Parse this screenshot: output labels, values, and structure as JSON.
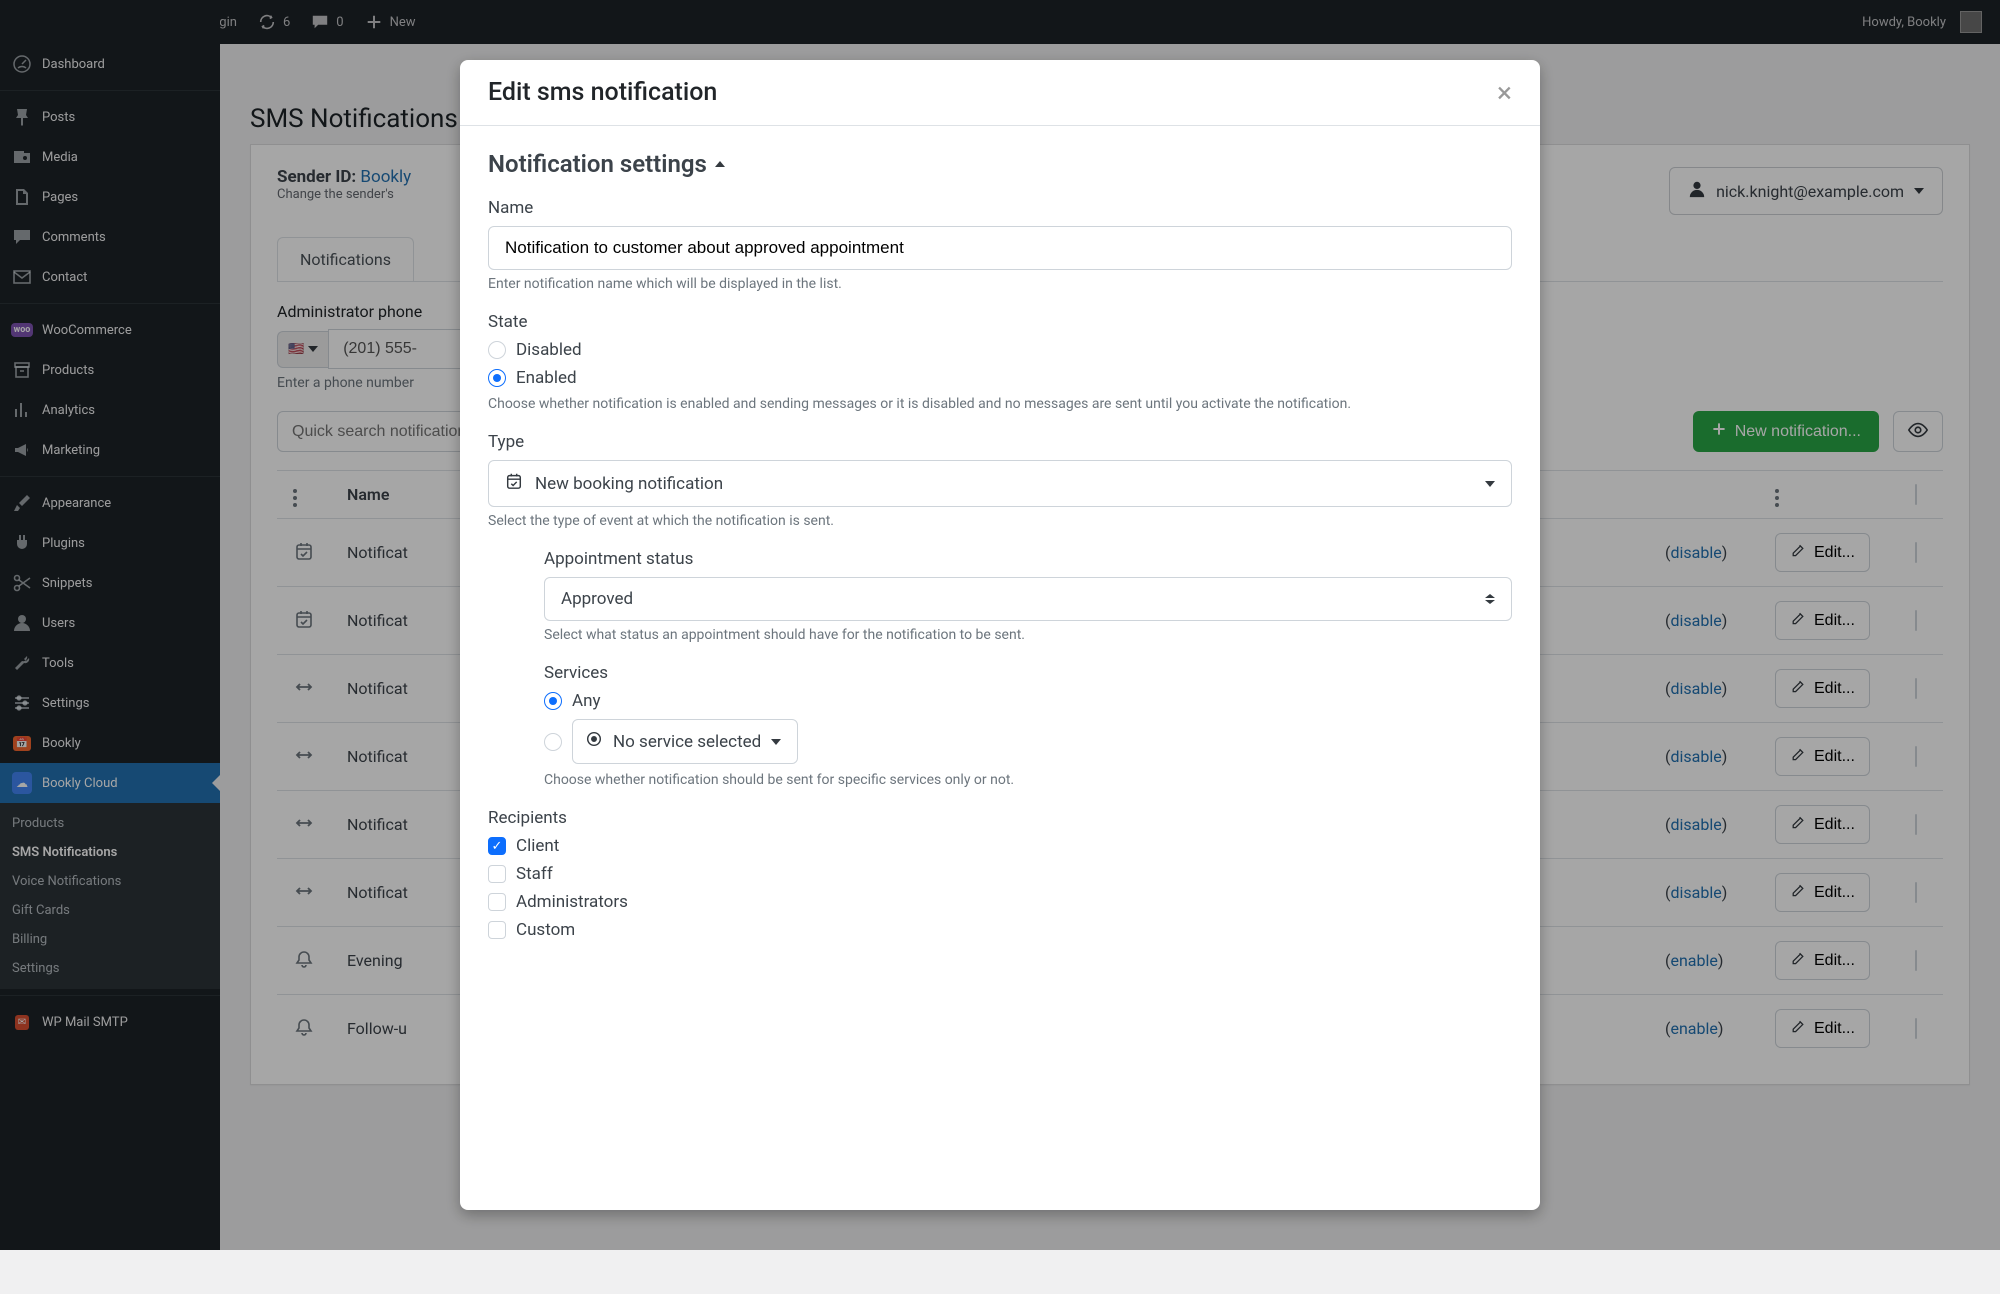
{
  "adminbar": {
    "site_name": "WordPress Booking Plugin",
    "updates": "6",
    "comments": "0",
    "new_label": "New",
    "howdy": "Howdy, Bookly"
  },
  "sidebar": {
    "items": [
      {
        "label": "Dashboard",
        "icon": "dashboard"
      },
      {
        "label": "Posts",
        "icon": "pin"
      },
      {
        "label": "Media",
        "icon": "media"
      },
      {
        "label": "Pages",
        "icon": "pages"
      },
      {
        "label": "Comments",
        "icon": "comment"
      },
      {
        "label": "Contact",
        "icon": "mail"
      },
      {
        "label": "WooCommerce",
        "icon": "woo"
      },
      {
        "label": "Products",
        "icon": "archive"
      },
      {
        "label": "Analytics",
        "icon": "chart"
      },
      {
        "label": "Marketing",
        "icon": "megaphone"
      },
      {
        "label": "Appearance",
        "icon": "brush"
      },
      {
        "label": "Plugins",
        "icon": "plug"
      },
      {
        "label": "Snippets",
        "icon": "scissors"
      },
      {
        "label": "Users",
        "icon": "user"
      },
      {
        "label": "Tools",
        "icon": "wrench"
      },
      {
        "label": "Settings",
        "icon": "sliders"
      },
      {
        "label": "Bookly",
        "icon": "calendar"
      },
      {
        "label": "Bookly Cloud",
        "icon": "cloud",
        "current": true
      }
    ],
    "sub": {
      "products": "Products",
      "sms": "SMS Notifications",
      "voice": "Voice Notifications",
      "gift": "Gift Cards",
      "billing": "Billing",
      "settings": "Settings"
    },
    "wp_mail": "WP Mail SMTP"
  },
  "page": {
    "title": "SMS Notifications",
    "sender_label": "Sender ID:",
    "sender_value": "Bookly",
    "sender_help": "Change the sender's",
    "user_email": "nick.knight@example.com",
    "tab_notifications": "Notifications",
    "admin_phone_label": "Administrator phone",
    "phone_value": "(201) 555-",
    "phone_help": "Enter a phone number",
    "search_placeholder": "Quick search notifications",
    "new_notification_btn": "New notification...",
    "col_name": "Name",
    "edit_btn": "Edit...",
    "rows": [
      {
        "icon": "calendar-check",
        "name": "Notificat",
        "state_action": "disable"
      },
      {
        "icon": "calendar-check",
        "name": "Notificat",
        "state_action": "disable"
      },
      {
        "icon": "arrows-h",
        "name": "Notificat",
        "state_action": "disable"
      },
      {
        "icon": "arrows-h",
        "name": "Notificat",
        "state_action": "disable"
      },
      {
        "icon": "arrows-h",
        "name": "Notificat",
        "state_action": "disable"
      },
      {
        "icon": "arrows-h",
        "name": "Notificat",
        "state_action": "disable"
      },
      {
        "icon": "bell",
        "name": "Evening",
        "state_action": "enable"
      },
      {
        "icon": "bell",
        "name": "Follow-u",
        "state_action": "enable"
      }
    ]
  },
  "modal": {
    "title": "Edit sms notification",
    "section_settings": "Notification settings",
    "label_name": "Name",
    "name_value": "Notification to customer about approved appointment",
    "name_help": "Enter notification name which will be displayed in the list.",
    "label_state": "State",
    "state_disabled": "Disabled",
    "state_enabled": "Enabled",
    "state_help": "Choose whether notification is enabled and sending messages or it is disabled and no messages are sent until you activate the notification.",
    "label_type": "Type",
    "type_value": "New booking notification",
    "type_help": "Select the type of event at which the notification is sent.",
    "label_appt_status": "Appointment status",
    "appt_status_value": "Approved",
    "appt_status_help": "Select what status an appointment should have for the notification to be sent.",
    "label_services": "Services",
    "services_any": "Any",
    "services_none": "No service selected",
    "services_help": "Choose whether notification should be sent for specific services only or not.",
    "label_recipients": "Recipients",
    "rec_client": "Client",
    "rec_staff": "Staff",
    "rec_admin": "Administrators",
    "rec_custom": "Custom"
  }
}
